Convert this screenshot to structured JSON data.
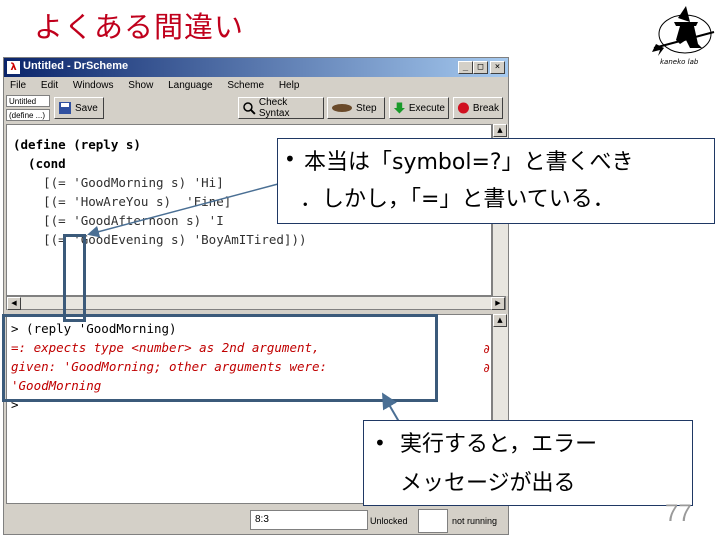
{
  "slide": {
    "title": "よくある間違い",
    "page_number": "77",
    "logo_caption": "kaneko lab"
  },
  "window": {
    "title": "Untitled - DrScheme",
    "controls": [
      "_",
      "□",
      "×"
    ],
    "menu": [
      "File",
      "Edit",
      "Windows",
      "Show",
      "Language",
      "Scheme",
      "Help"
    ],
    "toolbar": {
      "name_field": "Untitled",
      "define_field": "(define ...)",
      "save_label": "Save",
      "check_syntax_label": "Check Syntax",
      "step_label": "Step",
      "execute_label": "Execute",
      "break_label": "Break"
    },
    "editor_lines": [
      "(define (reply s)",
      "  (cond",
      "    [(= 'GoodMorning s) 'Hi]",
      "    [(= 'HowAreYou s)  'Fine]",
      "    [(= 'GoodAfternoon s) 'I",
      "    [(= 'GoodEvening s) 'BoyAmITired]))"
    ],
    "interaction_lines": [
      "> (reply 'GoodMorning)",
      "=: expects type <number> as 2nd argument,",
      "given: 'GoodMorning; other arguments were:",
      "'GoodMorning",
      ">"
    ],
    "status": {
      "position": "8:3",
      "unlocked": "Unlocked",
      "running": "not running"
    }
  },
  "callouts": {
    "top_line1": "本当は「symbol=?」と書くべき",
    "top_line2": "．しかし，「=」と書いている．",
    "bottom_line1": "実行すると，エラー",
    "bottom_line2": "メッセージが出る",
    "bullet": "•"
  },
  "colors": {
    "title": "#c0001c",
    "error_text": "#c00000",
    "frame": "#3b5a7a",
    "titlebar": "#0a246a"
  }
}
